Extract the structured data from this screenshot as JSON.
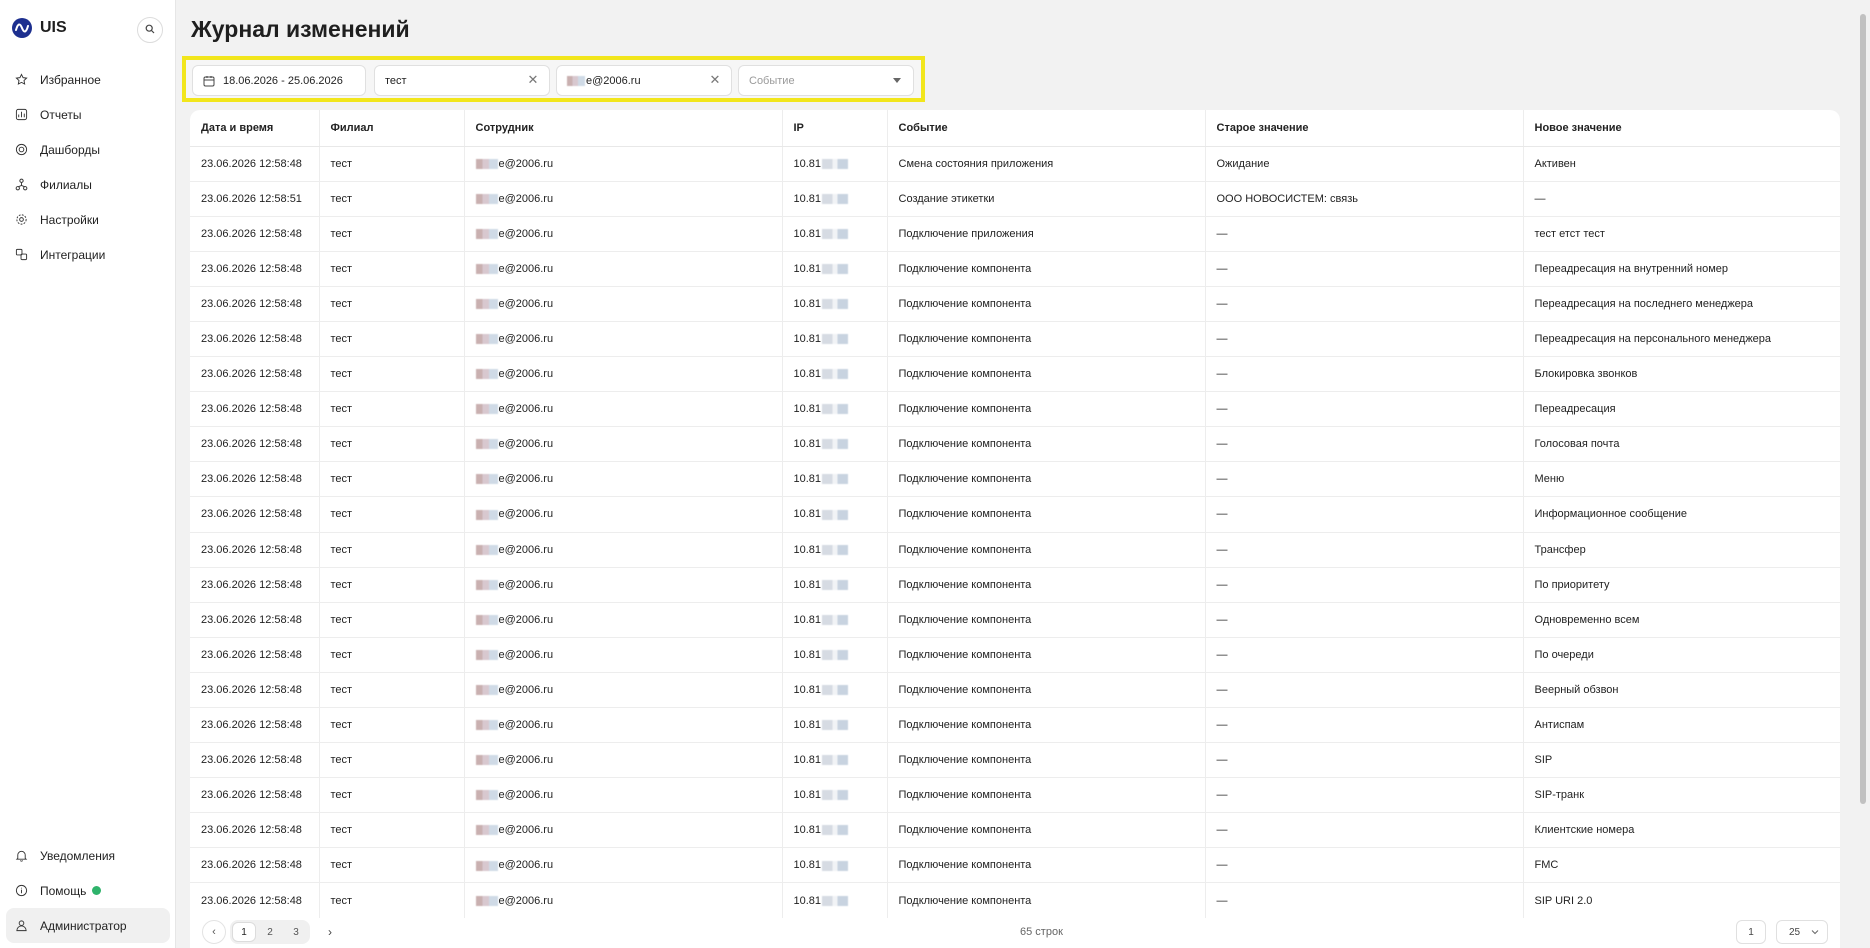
{
  "sidebar": {
    "brand": "UIS",
    "items": [
      {
        "label": "Избранное",
        "icon": "star-icon"
      },
      {
        "label": "Отчеты",
        "icon": "chart-icon"
      },
      {
        "label": "Дашборды",
        "icon": "dashboard-icon"
      },
      {
        "label": "Филиалы",
        "icon": "branches-icon"
      },
      {
        "label": "Настройки",
        "icon": "gear-icon"
      },
      {
        "label": "Интеграции",
        "icon": "integration-icon"
      }
    ],
    "bottom": [
      {
        "label": "Уведомления",
        "icon": "bell-icon"
      },
      {
        "label": "Помощь",
        "icon": "info-icon"
      },
      {
        "label": "Администратор",
        "icon": "user-icon"
      }
    ]
  },
  "page": {
    "title": "Журнал изменений"
  },
  "filters": {
    "date_range": "18.06.2026 - 25.06.2026",
    "branch": "тест",
    "employee": "e@2006.ru",
    "event_placeholder": "Событие"
  },
  "table": {
    "columns": [
      "Дата и время",
      "Филиал",
      "Сотрудник",
      "IP",
      "Событие",
      "Старое значение",
      "Новое значение"
    ],
    "rows": [
      [
        "23.06.2026 12:58:48",
        "тест",
        "e@2006.ru",
        "10.81",
        "Смена состояния приложения",
        "Ожидание",
        "Активен"
      ],
      [
        "23.06.2026 12:58:51",
        "тест",
        "e@2006.ru",
        "10.81",
        "Создание этикетки",
        "ООО НОВОСИСТЕМ: связь",
        "—"
      ],
      [
        "23.06.2026 12:58:48",
        "тест",
        "e@2006.ru",
        "10.81",
        "Подключение приложения",
        "—",
        "тест етст тест"
      ],
      [
        "23.06.2026 12:58:48",
        "тест",
        "e@2006.ru",
        "10.81",
        "Подключение компонента",
        "—",
        "Переадресация на внутренний номер"
      ],
      [
        "23.06.2026 12:58:48",
        "тест",
        "e@2006.ru",
        "10.81",
        "Подключение компонента",
        "—",
        "Переадресация на последнего менеджера"
      ],
      [
        "23.06.2026 12:58:48",
        "тест",
        "e@2006.ru",
        "10.81",
        "Подключение компонента",
        "—",
        "Переадресация на персонального менеджера"
      ],
      [
        "23.06.2026 12:58:48",
        "тест",
        "e@2006.ru",
        "10.81",
        "Подключение компонента",
        "—",
        "Блокировка звонков"
      ],
      [
        "23.06.2026 12:58:48",
        "тест",
        "e@2006.ru",
        "10.81",
        "Подключение компонента",
        "—",
        "Переадресация"
      ],
      [
        "23.06.2026 12:58:48",
        "тест",
        "e@2006.ru",
        "10.81",
        "Подключение компонента",
        "—",
        "Голосовая почта"
      ],
      [
        "23.06.2026 12:58:48",
        "тест",
        "e@2006.ru",
        "10.81",
        "Подключение компонента",
        "—",
        "Меню"
      ],
      [
        "23.06.2026 12:58:48",
        "тест",
        "e@2006.ru",
        "10.81",
        "Подключение компонента",
        "—",
        "Информационное сообщение"
      ],
      [
        "23.06.2026 12:58:48",
        "тест",
        "e@2006.ru",
        "10.81",
        "Подключение компонента",
        "—",
        "Трансфер"
      ],
      [
        "23.06.2026 12:58:48",
        "тест",
        "e@2006.ru",
        "10.81",
        "Подключение компонента",
        "—",
        "По приоритету"
      ],
      [
        "23.06.2026 12:58:48",
        "тест",
        "e@2006.ru",
        "10.81",
        "Подключение компонента",
        "—",
        "Одновременно всем"
      ],
      [
        "23.06.2026 12:58:48",
        "тест",
        "e@2006.ru",
        "10.81",
        "Подключение компонента",
        "—",
        "По очереди"
      ],
      [
        "23.06.2026 12:58:48",
        "тест",
        "e@2006.ru",
        "10.81",
        "Подключение компонента",
        "—",
        "Веерный обзвон"
      ],
      [
        "23.06.2026 12:58:48",
        "тест",
        "e@2006.ru",
        "10.81",
        "Подключение компонента",
        "—",
        "Антиспам"
      ],
      [
        "23.06.2026 12:58:48",
        "тест",
        "e@2006.ru",
        "10.81",
        "Подключение компонента",
        "—",
        "SIP"
      ],
      [
        "23.06.2026 12:58:48",
        "тест",
        "e@2006.ru",
        "10.81",
        "Подключение компонента",
        "—",
        "SIP-транк"
      ],
      [
        "23.06.2026 12:58:48",
        "тест",
        "e@2006.ru",
        "10.81",
        "Подключение компонента",
        "—",
        "Клиентские номера"
      ],
      [
        "23.06.2026 12:58:48",
        "тест",
        "e@2006.ru",
        "10.81",
        "Подключение компонента",
        "—",
        "FMC"
      ],
      [
        "23.06.2026 12:58:48",
        "тест",
        "e@2006.ru",
        "10.81",
        "Подключение компонента",
        "—",
        "SIP URI 2.0"
      ]
    ]
  },
  "footer": {
    "pages": [
      "1",
      "2",
      "3"
    ],
    "rows_total": "65 строк",
    "current_page": "1",
    "per_page": "25"
  },
  "colors": {
    "accent": "#1d2f8f",
    "highlight": "#f2e61c",
    "help_dot": "#2fb36b"
  }
}
